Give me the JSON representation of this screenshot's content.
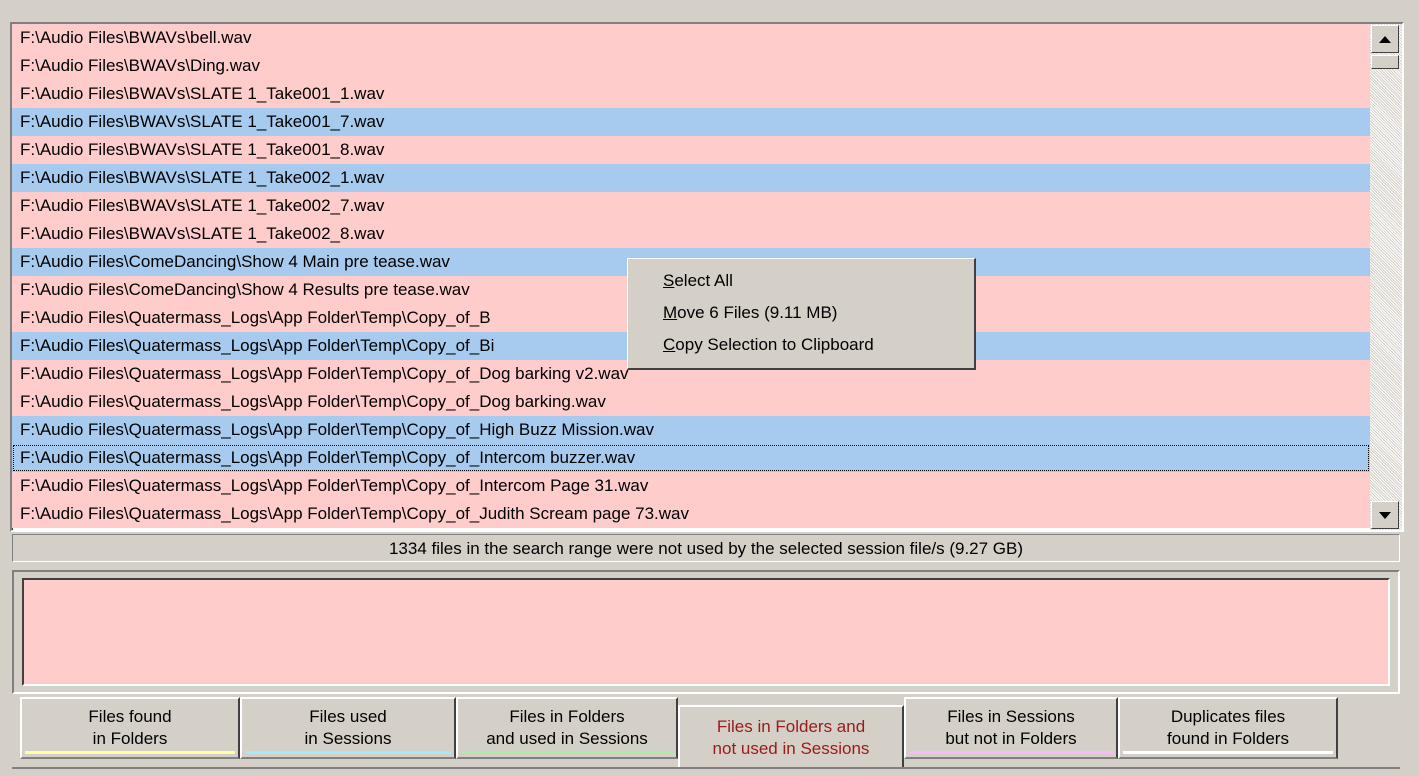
{
  "file_list": {
    "rows": [
      {
        "path": "F:\\Audio Files\\BWAVs\\bell.wav",
        "state": "pink"
      },
      {
        "path": "F:\\Audio Files\\BWAVs\\Ding.wav",
        "state": "pink"
      },
      {
        "path": "F:\\Audio Files\\BWAVs\\SLATE 1_Take001_1.wav",
        "state": "pink"
      },
      {
        "path": "F:\\Audio Files\\BWAVs\\SLATE 1_Take001_7.wav",
        "state": "blue"
      },
      {
        "path": "F:\\Audio Files\\BWAVs\\SLATE 1_Take001_8.wav",
        "state": "pink"
      },
      {
        "path": "F:\\Audio Files\\BWAVs\\SLATE 1_Take002_1.wav",
        "state": "blue"
      },
      {
        "path": "F:\\Audio Files\\BWAVs\\SLATE 1_Take002_7.wav",
        "state": "pink"
      },
      {
        "path": "F:\\Audio Files\\BWAVs\\SLATE 1_Take002_8.wav",
        "state": "pink"
      },
      {
        "path": "F:\\Audio Files\\ComeDancing\\Show 4 Main pre tease.wav",
        "state": "blue"
      },
      {
        "path": "F:\\Audio Files\\ComeDancing\\Show 4 Results pre tease.wav",
        "state": "pink"
      },
      {
        "path": "F:\\Audio Files\\Quatermass_Logs\\App Folder\\Temp\\Copy_of_B",
        "state": "pink"
      },
      {
        "path": "F:\\Audio Files\\Quatermass_Logs\\App Folder\\Temp\\Copy_of_Bi",
        "state": "blue"
      },
      {
        "path": "F:\\Audio Files\\Quatermass_Logs\\App Folder\\Temp\\Copy_of_Dog barking v2.wav",
        "state": "pink"
      },
      {
        "path": "F:\\Audio Files\\Quatermass_Logs\\App Folder\\Temp\\Copy_of_Dog barking.wav",
        "state": "pink"
      },
      {
        "path": "F:\\Audio Files\\Quatermass_Logs\\App Folder\\Temp\\Copy_of_High Buzz Mission.wav",
        "state": "blue"
      },
      {
        "path": "F:\\Audio Files\\Quatermass_Logs\\App Folder\\Temp\\Copy_of_Intercom buzzer.wav",
        "state": "blue",
        "focused": true
      },
      {
        "path": "F:\\Audio Files\\Quatermass_Logs\\App Folder\\Temp\\Copy_of_Intercom Page 31.wav",
        "state": "pink"
      },
      {
        "path": "F:\\Audio Files\\Quatermass_Logs\\App Folder\\Temp\\Copy_of_Judith Scream page 73.wav",
        "state": "pink"
      }
    ]
  },
  "status_text": "1334 files in the search range were not used by the selected session file/s (9.27 GB)",
  "context_menu": {
    "items": [
      {
        "label": "Select All",
        "accel": "S"
      },
      {
        "label": "Move 6 Files (9.11 MB)",
        "accel": "M"
      },
      {
        "label": "Copy Selection to Clipboard",
        "accel": "C"
      }
    ]
  },
  "tabs": [
    {
      "line1": "Files found",
      "line2": "in Folders",
      "color": "#ffffa0"
    },
    {
      "line1": "Files used",
      "line2": "in Sessions",
      "color": "#a6e6ff"
    },
    {
      "line1": "Files in Folders",
      "line2": "and used in Sessions",
      "color": "#a6f0a6"
    },
    {
      "line1": "Files in Folders and",
      "line2": "not used in Sessions",
      "color": "#ffcccc",
      "active": true
    },
    {
      "line1": "Files in Sessions",
      "line2": "but not in Folders",
      "color": "#ffb6ff"
    },
    {
      "line1": "Duplicates files",
      "line2": "found in Folders",
      "color": "#ffffff"
    }
  ],
  "colors": {
    "unused_pink": "#ffcccc",
    "selected_blue": "#a6cbef",
    "active_tab_text": "#9a1a1a"
  }
}
